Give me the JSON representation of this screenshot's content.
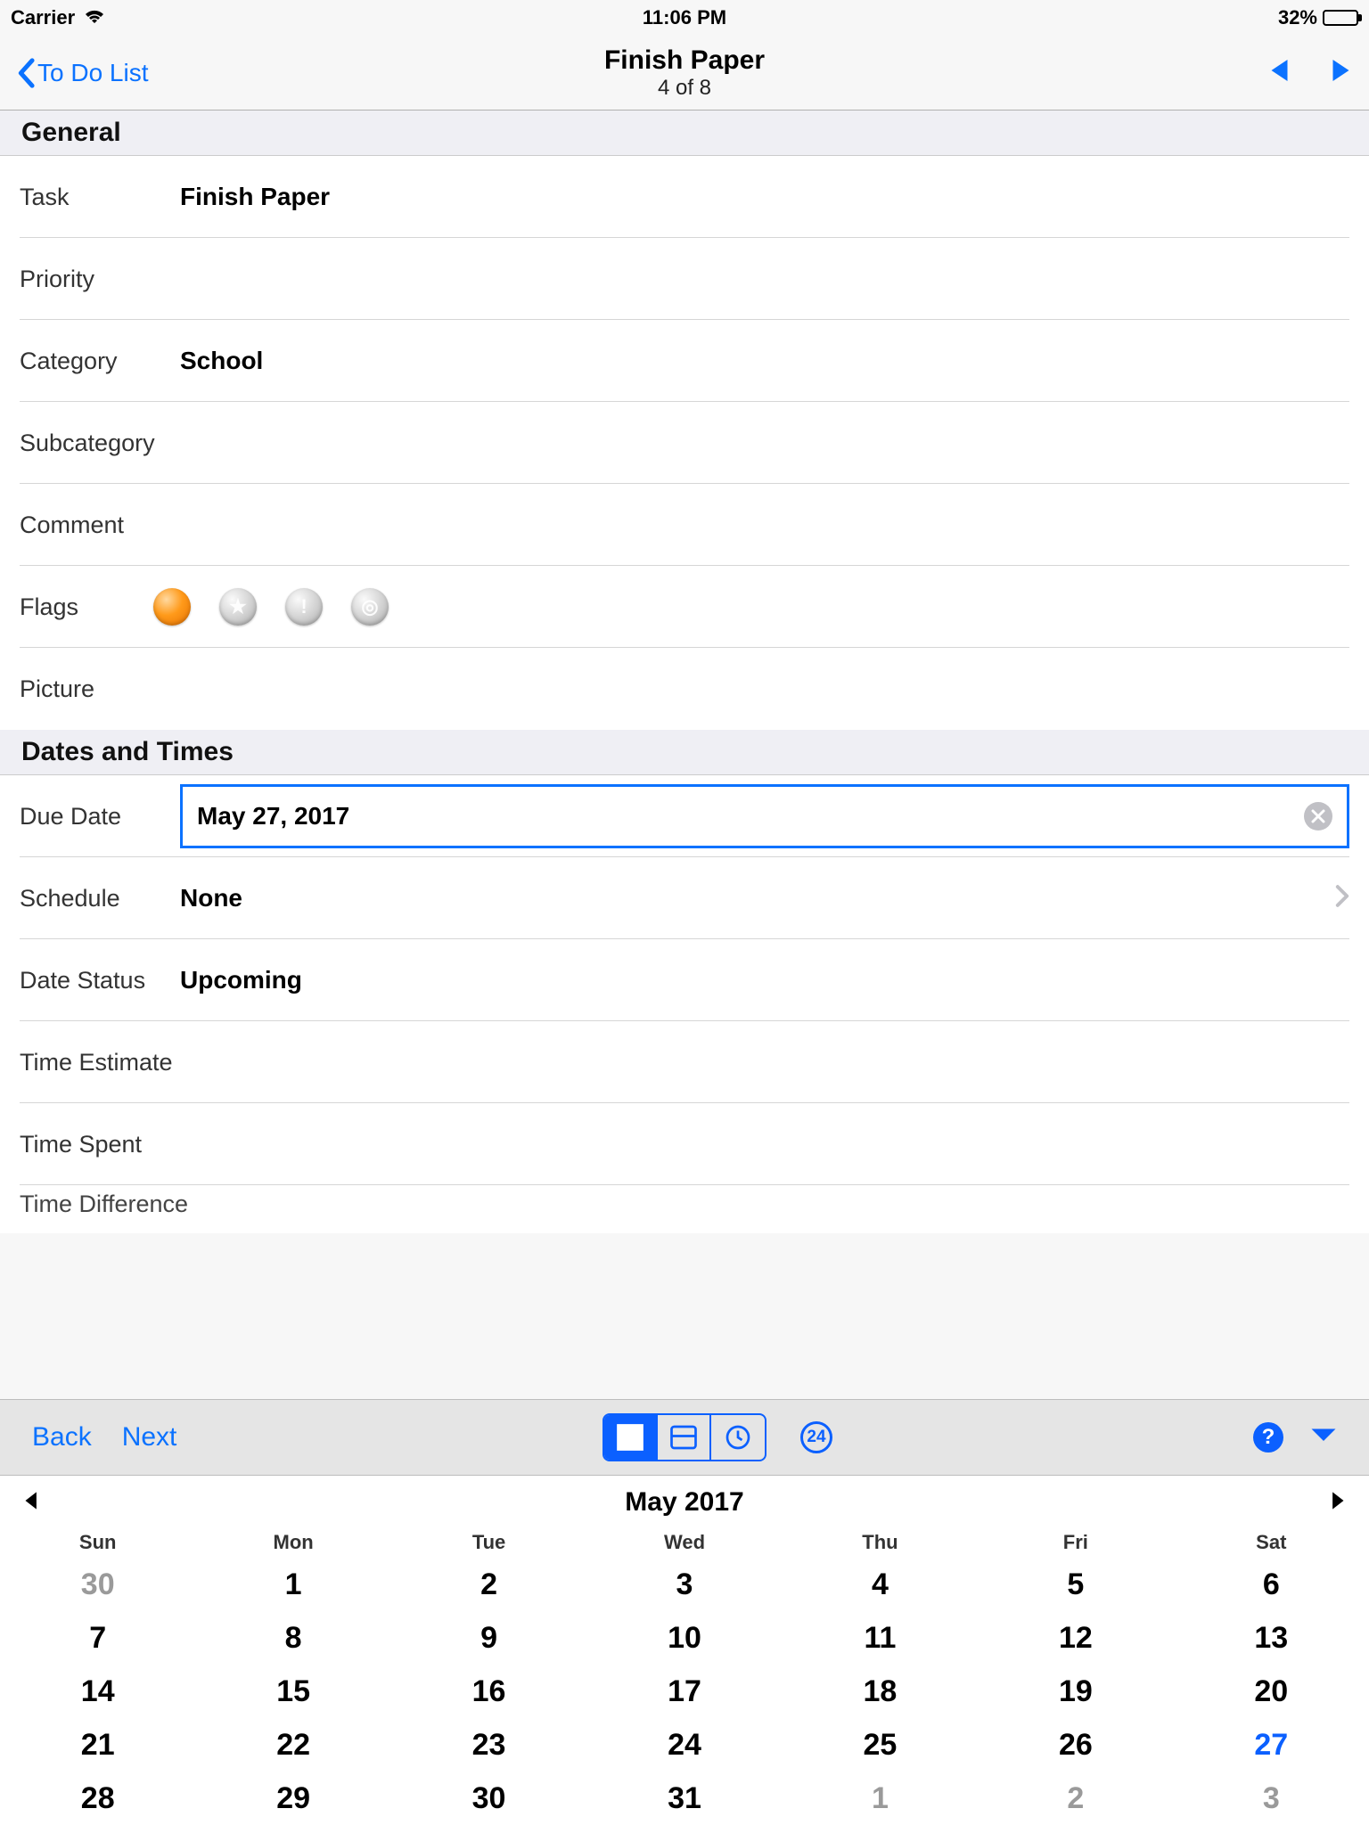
{
  "status": {
    "carrier": "Carrier",
    "time": "11:06 PM",
    "battery_pct": "32%"
  },
  "nav": {
    "back": "To Do List",
    "title": "Finish Paper",
    "subtitle": "4 of 8"
  },
  "sections": {
    "general": "General",
    "dates": "Dates and Times"
  },
  "fields": {
    "task": {
      "label": "Task",
      "value": "Finish Paper"
    },
    "priority": {
      "label": "Priority",
      "value": ""
    },
    "category": {
      "label": "Category",
      "value": "School"
    },
    "subcategory": {
      "label": "Subcategory",
      "value": ""
    },
    "comment": {
      "label": "Comment",
      "value": ""
    },
    "flags": {
      "label": "Flags"
    },
    "picture": {
      "label": "Picture",
      "value": ""
    },
    "due_date": {
      "label": "Due Date",
      "value": "May 27, 2017"
    },
    "schedule": {
      "label": "Schedule",
      "value": "None"
    },
    "date_status": {
      "label": "Date Status",
      "value": "Upcoming"
    },
    "time_estimate": {
      "label": "Time Estimate",
      "value": ""
    },
    "time_spent": {
      "label": "Time Spent",
      "value": ""
    },
    "time_diff": {
      "label": "Time Difference",
      "value": ""
    }
  },
  "toolbar": {
    "back": "Back",
    "next": "Next",
    "badge24": "24"
  },
  "calendar": {
    "month": "May 2017",
    "dow": [
      "Sun",
      "Mon",
      "Tue",
      "Wed",
      "Thu",
      "Fri",
      "Sat"
    ],
    "weeks": [
      [
        {
          "d": "30",
          "o": true
        },
        {
          "d": "1"
        },
        {
          "d": "2"
        },
        {
          "d": "3"
        },
        {
          "d": "4"
        },
        {
          "d": "5"
        },
        {
          "d": "6"
        }
      ],
      [
        {
          "d": "7"
        },
        {
          "d": "8"
        },
        {
          "d": "9"
        },
        {
          "d": "10"
        },
        {
          "d": "11"
        },
        {
          "d": "12"
        },
        {
          "d": "13"
        }
      ],
      [
        {
          "d": "14"
        },
        {
          "d": "15"
        },
        {
          "d": "16"
        },
        {
          "d": "17"
        },
        {
          "d": "18"
        },
        {
          "d": "19"
        },
        {
          "d": "20"
        }
      ],
      [
        {
          "d": "21"
        },
        {
          "d": "22"
        },
        {
          "d": "23"
        },
        {
          "d": "24"
        },
        {
          "d": "25"
        },
        {
          "d": "26"
        },
        {
          "d": "27",
          "sel": true
        }
      ],
      [
        {
          "d": "28"
        },
        {
          "d": "29"
        },
        {
          "d": "30"
        },
        {
          "d": "31"
        },
        {
          "d": "1",
          "o": true
        },
        {
          "d": "2",
          "o": true
        },
        {
          "d": "3",
          "o": true
        }
      ]
    ]
  }
}
